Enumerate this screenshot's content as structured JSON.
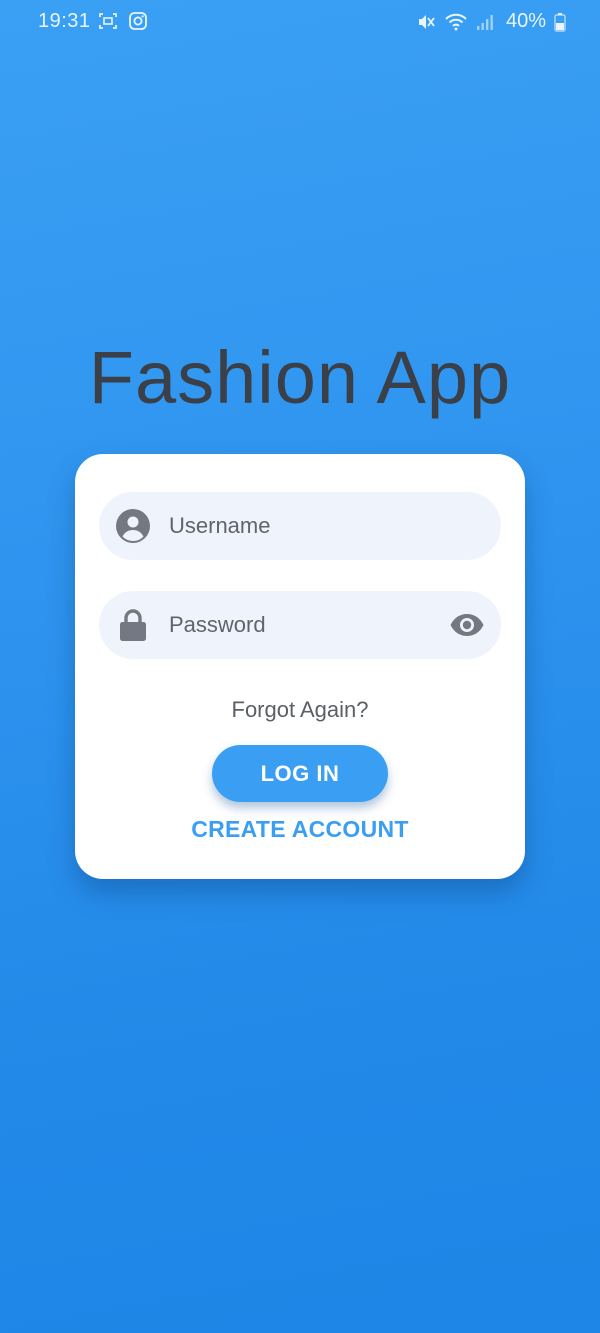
{
  "status_bar": {
    "time": "19:31",
    "left_icons": [
      "screenshot-icon",
      "instagram-icon"
    ],
    "right_icons": [
      "mute-icon",
      "wifi-icon",
      "signal-icon",
      "battery-icon"
    ],
    "battery_level": "40%"
  },
  "app": {
    "title": "Fashion App"
  },
  "login": {
    "username_placeholder": "Username",
    "username_value": "",
    "password_placeholder": "Password",
    "password_value": "",
    "forgot_label": "Forgot Again?",
    "login_label": "LOG IN",
    "create_account_label": "CREATE ACCOUNT"
  },
  "colors": {
    "background": "#2f94ef",
    "accent": "#3a9ff3",
    "card": "#ffffff",
    "field": "#eef3fc",
    "title": "#3b3f48",
    "icon": "#747882"
  },
  "icons": {
    "username_field": "account-circle-icon",
    "password_field": "lock-icon",
    "password_toggle": "eye-icon"
  }
}
